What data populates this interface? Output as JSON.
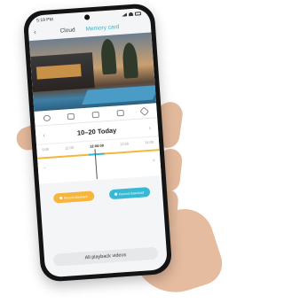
{
  "status": {
    "time": "5:19 PM"
  },
  "tabs": [
    {
      "label": "Cloud"
    },
    {
      "label": "Memory card"
    }
  ],
  "date_label": "10–20 Today",
  "timeline": {
    "ticks": [
      "9:00",
      "11:00",
      "12:00:00",
      "13:00",
      "14:00"
    ],
    "zoom_out": "−",
    "zoom_in": "+"
  },
  "actions": {
    "record_label": "Record playback",
    "download_label": "Record download"
  },
  "all_videos_label": "All playback videos",
  "colors": {
    "accent": "#25b8d2",
    "orange": "#f6b53b",
    "teal": "#37b9d6"
  },
  "icons": [
    "back-arrow-icon",
    "snapshot-icon",
    "record-icon",
    "speaker-icon",
    "fullscreen-icon",
    "expand-icon",
    "prev-day-icon",
    "next-day-icon"
  ]
}
